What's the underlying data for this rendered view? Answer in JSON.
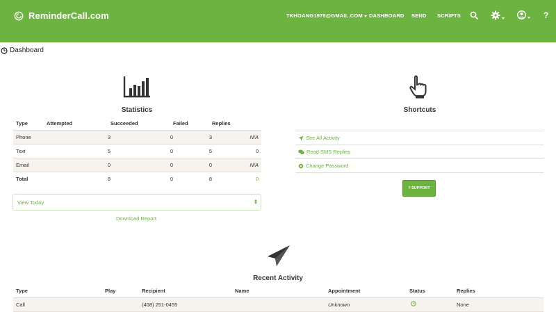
{
  "nav": {
    "brand": "ReminderCall.com",
    "account": "TKHOANG1979@GMAIL.COM",
    "dashboard": "DASHBOARD",
    "send": "SEND",
    "scripts": "SCRIPTS",
    "help": "?",
    "icons": [
      "search-icon",
      "gear-icon",
      "user-icon"
    ]
  },
  "breadcrumb": "Dashboard",
  "statistics": {
    "title": "Statistics",
    "headers": [
      "Type",
      "Attempted",
      "Succeeded",
      "Failed",
      "Replies"
    ],
    "rows": [
      [
        "Phone",
        "3",
        "0",
        "3",
        "N/A"
      ],
      [
        "Text",
        "5",
        "0",
        "5",
        "0"
      ],
      [
        "Email",
        "0",
        "0",
        "0",
        "N/A"
      ],
      [
        "Total",
        "8",
        "0",
        "8",
        "0"
      ]
    ],
    "period": "View Today",
    "download": "Download Report"
  },
  "shortcuts": {
    "title": "Shortcuts",
    "items": [
      "See All Activity",
      "Read SMS Replies",
      "Change Password"
    ],
    "support": "? SUPPORT"
  },
  "recent": {
    "title": "Recent Activity",
    "headers": [
      "Type",
      "Play",
      "Recipient",
      "Name",
      "Appointment",
      "Status",
      "Replies"
    ],
    "rows": [
      [
        "Call",
        "",
        "(408) 251-0455",
        "",
        "Unknown",
        "",
        "None"
      ]
    ]
  },
  "colors": {
    "brand_green": "#6cb33f"
  }
}
